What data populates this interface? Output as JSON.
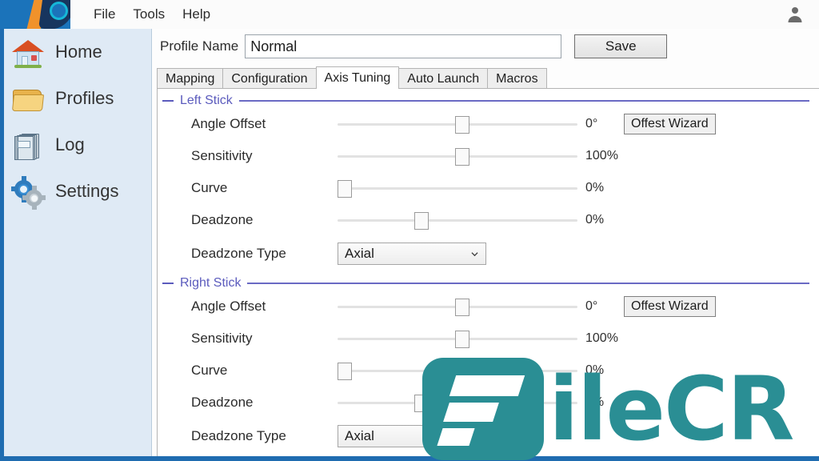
{
  "window": {
    "accent_blue": "#1f6cb0",
    "logo_icon": "app-logo-icon",
    "account_icon": "account-icon"
  },
  "menubar": {
    "items": [
      {
        "label": "File",
        "name": "menu-file"
      },
      {
        "label": "Tools",
        "name": "menu-tools"
      },
      {
        "label": "Help",
        "name": "menu-help"
      }
    ]
  },
  "sidebar": {
    "items": [
      {
        "label": "Home",
        "icon": "house-icon"
      },
      {
        "label": "Profiles",
        "icon": "folder-icon"
      },
      {
        "label": "Log",
        "icon": "books-icon"
      },
      {
        "label": "Settings",
        "icon": "gears-icon"
      }
    ]
  },
  "profile": {
    "label": "Profile Name",
    "value": "Normal",
    "placeholder": "",
    "save_label": "Save"
  },
  "tabs": [
    {
      "label": "Mapping",
      "active": false
    },
    {
      "label": "Configuration",
      "active": false
    },
    {
      "label": "Axis Tuning",
      "active": true
    },
    {
      "label": "Auto Launch",
      "active": false
    },
    {
      "label": "Macros",
      "active": false
    }
  ],
  "groups": {
    "left": {
      "title": "Left Stick",
      "accent": "#5b5bbd",
      "rows": [
        {
          "label": "Angle Offset",
          "value": "0°",
          "thumb_pct": 50,
          "button": "Offest Wizard"
        },
        {
          "label": "Sensitivity",
          "value": "100%",
          "thumb_pct": 50,
          "button": ""
        },
        {
          "label": "Curve",
          "value": "0%",
          "thumb_pct": 1,
          "button": ""
        },
        {
          "label": "Deadzone",
          "value": "0%",
          "thumb_pct": 33,
          "button": ""
        }
      ],
      "select_label": "Deadzone Type",
      "select_value": "Axial"
    },
    "right": {
      "title": "Right Stick",
      "accent": "#5b5bbd",
      "rows": [
        {
          "label": "Angle Offset",
          "value": "0°",
          "thumb_pct": 50,
          "button": "Offest Wizard"
        },
        {
          "label": "Sensitivity",
          "value": "100%",
          "thumb_pct": 50,
          "button": ""
        },
        {
          "label": "Curve",
          "value": "0%",
          "thumb_pct": 1,
          "button": ""
        },
        {
          "label": "Deadzone",
          "value": "0%",
          "thumb_pct": 33,
          "button": ""
        }
      ],
      "select_label": "Deadzone Type",
      "select_value": "Axial"
    }
  },
  "watermark": {
    "text": "ileCR",
    "color": "#2a8e94",
    "logo_letter": "F"
  }
}
